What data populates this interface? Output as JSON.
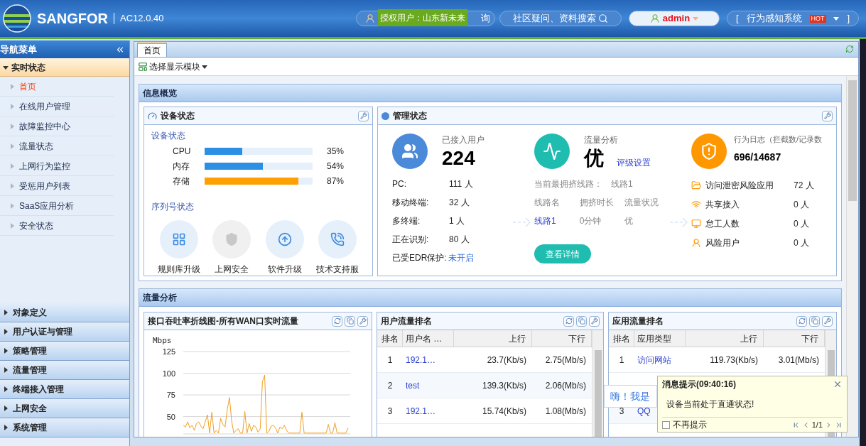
{
  "header": {
    "brand": "SANGFOR",
    "version": "AC12.0.40",
    "license_badge": "授权用户：山东新未来",
    "consult_text": "询",
    "search_placeholder": "社区疑问、资料搜索",
    "user": "admin",
    "system": {
      "open": "[",
      "label": "行为感知系统",
      "hot": "HOT",
      "close": "]"
    }
  },
  "sidebar": {
    "title": "导航菜单",
    "groups": [
      {
        "label": "实时状态",
        "expanded": true,
        "children": [
          {
            "label": "首页",
            "selected": true
          },
          {
            "label": "在线用户管理",
            "selected": false
          },
          {
            "label": "故障监控中心",
            "selected": false
          },
          {
            "label": "流量状态",
            "selected": false
          },
          {
            "label": "上网行为监控",
            "selected": false
          },
          {
            "label": "受惩用户列表",
            "selected": false
          },
          {
            "label": "SaaS应用分析",
            "selected": false
          },
          {
            "label": "安全状态",
            "selected": false
          }
        ]
      },
      {
        "label": "对象定义",
        "expanded": false
      },
      {
        "label": "用户认证与管理",
        "expanded": false
      },
      {
        "label": "策略管理",
        "expanded": false
      },
      {
        "label": "流量管理",
        "expanded": false
      },
      {
        "label": "终端接入管理",
        "expanded": false
      },
      {
        "label": "上网安全",
        "expanded": false
      },
      {
        "label": "系统管理",
        "expanded": false
      }
    ]
  },
  "tabs": [
    {
      "label": "首页",
      "selected": true
    }
  ],
  "toolbar": {
    "module_button": "选择显示模块"
  },
  "overview": {
    "title": "信息概览",
    "device": {
      "title": "设备状态",
      "subtitle": "设备状态",
      "meters": [
        {
          "name": "CPU",
          "level": 0.35,
          "reading": "35%",
          "color": "#2b8fe3"
        },
        {
          "name": "内存",
          "level": 0.54,
          "reading": "54%",
          "color": "#2b8fe3"
        },
        {
          "name": "存储",
          "level": 0.87,
          "reading": "87%",
          "color": "#ff9f00"
        }
      ],
      "serial_title": "序列号状态",
      "serial_items": [
        {
          "kind": "rules",
          "label": "规则库升级",
          "enabled": true
        },
        {
          "kind": "shield",
          "label": "上网安全",
          "enabled": false
        },
        {
          "kind": "upgrade",
          "label": "软件升级",
          "enabled": true
        },
        {
          "kind": "support",
          "label": "技术支持服",
          "enabled": true
        }
      ]
    },
    "management": {
      "title": "管理状态",
      "users": {
        "label": "已接入用户",
        "value": "224",
        "rows": [
          {
            "label": "PC:",
            "value": "111 人"
          },
          {
            "label": "移动终端:",
            "value": "32 人"
          },
          {
            "label": "多终端:",
            "value": "1 人"
          },
          {
            "label": "正在识别:",
            "value": "80 人"
          }
        ],
        "edr_label": "已受EDR保护:",
        "edr_value": "未开启"
      },
      "traffic": {
        "label": "流量分析",
        "grade": "优",
        "link": "评级设置",
        "busiest_label": "当前最拥挤线路：",
        "busiest_value": "线路1",
        "columns": [
          "线路名",
          "拥挤时长",
          "流量状况"
        ],
        "row": [
          "线路1",
          "0分钟",
          "优"
        ],
        "button": "查看详情"
      },
      "log": {
        "label": "行为日志（拦截数/记录数",
        "value": "696/14687",
        "rows": [
          {
            "kind": "folder",
            "label": "访问泄密风险应用",
            "value": "72 人"
          },
          {
            "kind": "wifi",
            "label": "共享接入",
            "value": "0 人"
          },
          {
            "kind": "monitor",
            "label": "怠工人数",
            "value": "0 人"
          },
          {
            "kind": "user",
            "label": "风险用户",
            "value": "0 人"
          }
        ]
      }
    }
  },
  "traffic": {
    "title": "流量分析",
    "chart_panel": {
      "title": "接口吞吐率折线图-所有WAN口实时流量",
      "chart_data": {
        "type": "line",
        "ylabel": "Mbps",
        "ylim": [
          30,
          125
        ],
        "yticks": [
          50,
          75,
          100,
          125
        ],
        "grid": true,
        "series": [
          {
            "color": "#f0a020",
            "values": [
              40,
              38,
              44,
              37,
              40,
              34,
              42,
              44,
              39,
              36,
              44,
              52,
              31,
              55,
              31,
              34,
              31,
              48,
              41,
              38,
              58,
              72,
              45,
              31,
              34,
              36,
              31,
              31,
              56,
              31,
              42,
              33,
              40,
              38,
              32,
              36,
              90,
              98,
              31,
              33,
              39,
              40,
              37,
              31,
              38,
              36,
              40,
              34,
              31,
              31,
              31,
              31,
              31,
              31,
              55,
              31,
              31,
              31,
              31,
              31,
              31,
              31,
              31,
              31,
              31,
              31,
              41,
              31,
              31,
              43,
              31,
              31,
              31,
              31,
              31,
              37
            ]
          }
        ]
      }
    },
    "user_rank": {
      "title": "用户流量排名",
      "columns": [
        "排名",
        "用户名 …",
        "上行",
        "下行"
      ],
      "rows": [
        [
          "1",
          "192.1…",
          "23.7(Kb/s)",
          "2.75(Mb/s)"
        ],
        [
          "2",
          "test",
          "139.3(Kb/s)",
          "2.06(Mb/s)"
        ],
        [
          "3",
          "192.1…",
          "15.74(Kb/s)",
          "1.08(Mb/s)"
        ]
      ]
    },
    "app_rank": {
      "title": "应用流量排名",
      "columns": [
        "排名",
        "应用类型",
        "上行",
        "下行"
      ],
      "rows": [
        [
          "1",
          "访问网站",
          "119.73(Kb/s)",
          "3.01(Mb/s)"
        ],
        [
          "3",
          "QQ"
        ]
      ]
    },
    "chat_bubble": "嗨！我是"
  },
  "popup": {
    "title": "消息提示(09:40:16)",
    "message": "设备当前处于直通状态!",
    "checkbox": {
      "label": "不再提示",
      "checked": false
    },
    "pager": "1/1"
  }
}
